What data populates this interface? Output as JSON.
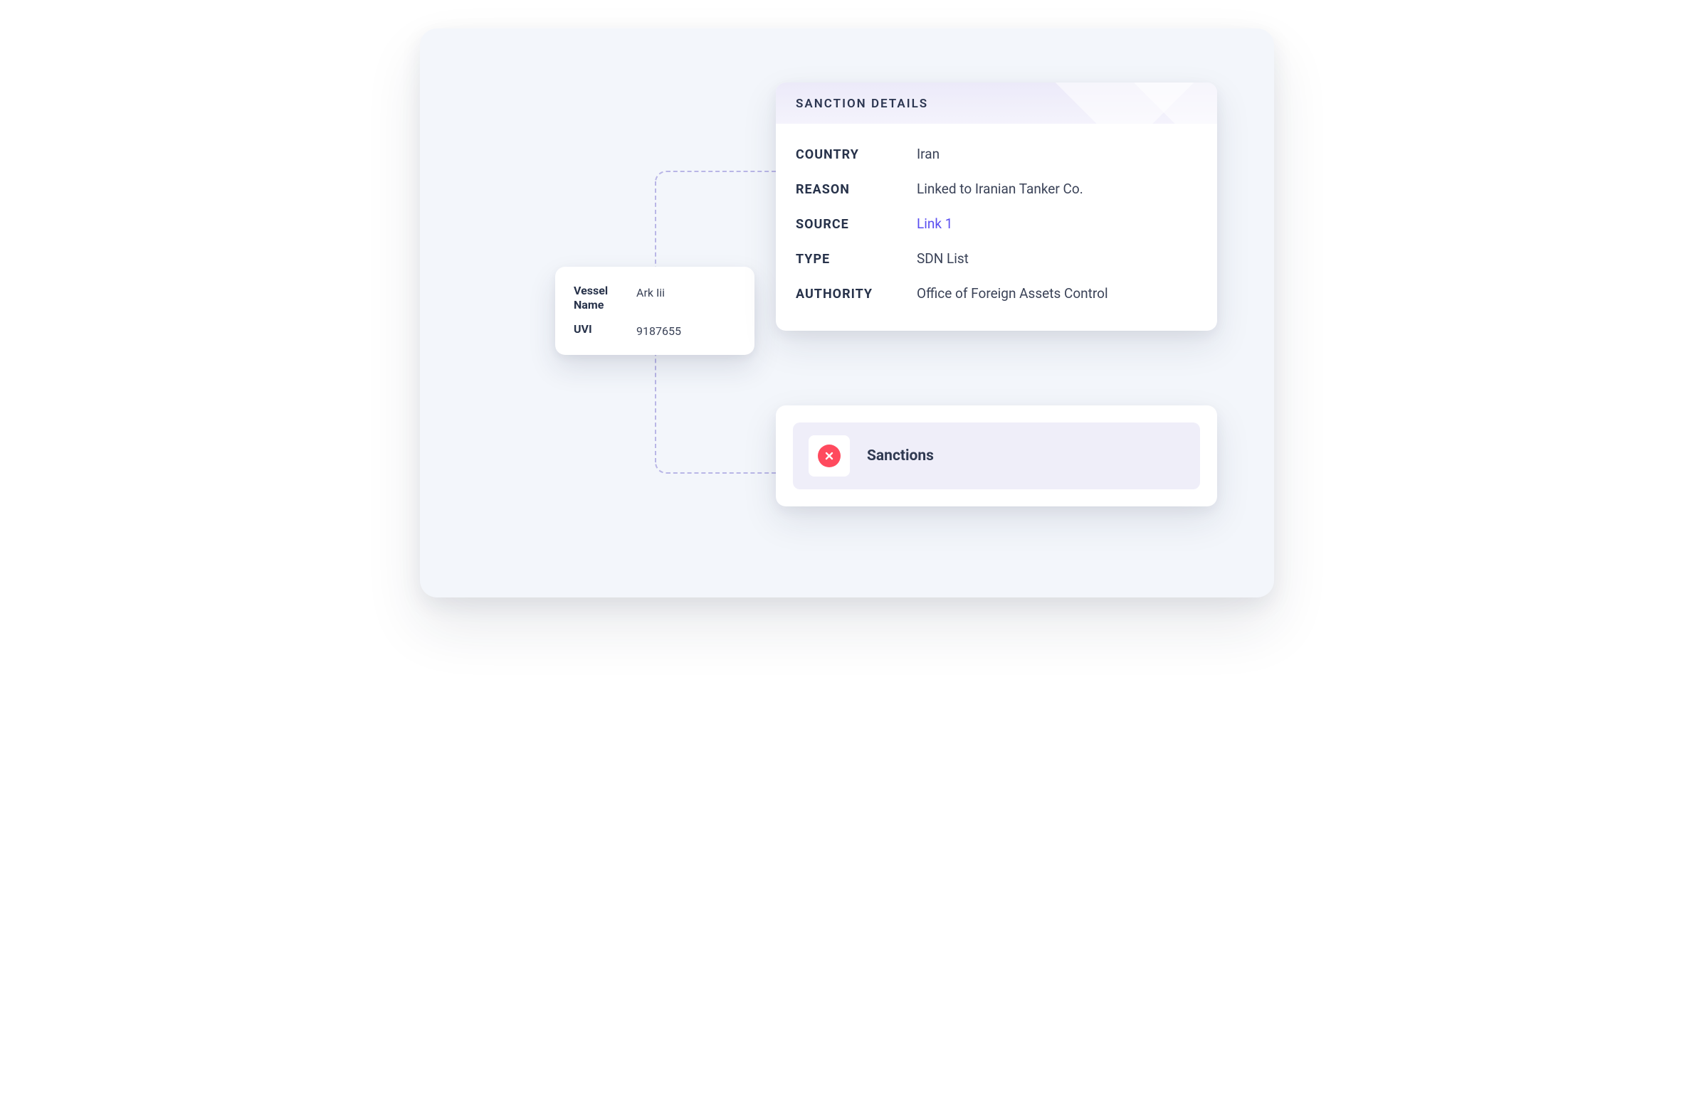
{
  "vessel": {
    "name_label": "Vessel Name",
    "name_value": "Ark Iii",
    "uvi_label": "UVI",
    "uvi_value": "9187655"
  },
  "details": {
    "header": "SANCTION DETAILS",
    "rows": {
      "country_label": "COUNTRY",
      "country_value": "Iran",
      "reason_label": "REASON",
      "reason_value": "Linked to Iranian Tanker Co.",
      "source_label": "SOURCE",
      "source_value": "Link 1",
      "type_label": "TYPE",
      "type_value": "SDN List",
      "authority_label": "AUTHORITY",
      "authority_value": "Office of Foreign Assets Control"
    }
  },
  "status": {
    "label": "Sanctions"
  },
  "colors": {
    "link": "#5a4ff0",
    "danger": "#ff4a5e"
  }
}
